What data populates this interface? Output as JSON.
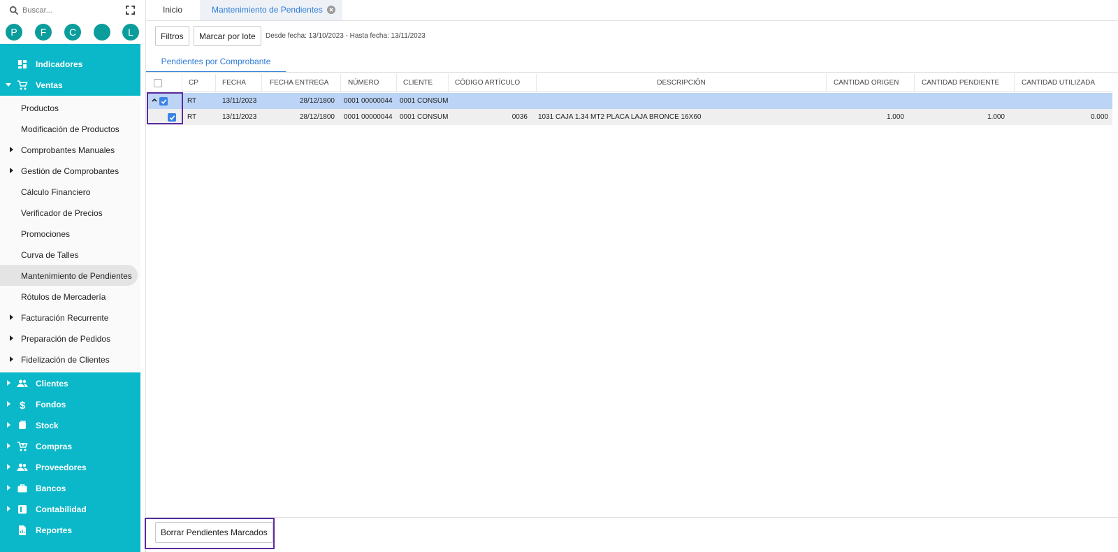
{
  "sidebar": {
    "search_placeholder": "Buscar...",
    "avatars": [
      "P",
      "F",
      "C",
      "",
      "L"
    ],
    "sections_top": [
      {
        "label": "Indicadores",
        "icon": "dashboard-icon"
      },
      {
        "label": "Ventas",
        "icon": "cart-icon",
        "expanded": true
      }
    ],
    "ventas_items": [
      {
        "label": "Productos",
        "has_children": false
      },
      {
        "label": "Modificación de Productos",
        "has_children": false
      },
      {
        "label": "Comprobantes Manuales",
        "has_children": true
      },
      {
        "label": "Gestión de Comprobantes",
        "has_children": true
      },
      {
        "label": "Cálculo Financiero",
        "has_children": false
      },
      {
        "label": "Verificador de Precios",
        "has_children": false
      },
      {
        "label": "Promociones",
        "has_children": false
      },
      {
        "label": "Curva de Talles",
        "has_children": false
      },
      {
        "label": "Mantenimiento de Pendientes",
        "has_children": false,
        "active": true
      },
      {
        "label": "Rótulos de Mercadería",
        "has_children": false
      },
      {
        "label": "Facturación Recurrente",
        "has_children": true
      },
      {
        "label": "Preparación de Pedidos",
        "has_children": true
      },
      {
        "label": "Fidelización de Clientes",
        "has_children": true
      }
    ],
    "sections_bottom": [
      {
        "label": "Clientes",
        "icon": "people-icon"
      },
      {
        "label": "Fondos",
        "icon": "dollar-icon"
      },
      {
        "label": "Stock",
        "icon": "stock-icon"
      },
      {
        "label": "Compras",
        "icon": "cart-plus-icon"
      },
      {
        "label": "Proveedores",
        "icon": "people-icon"
      },
      {
        "label": "Bancos",
        "icon": "briefcase-icon"
      },
      {
        "label": "Contabilidad",
        "icon": "book-icon"
      },
      {
        "label": "Reportes",
        "icon": "report-icon"
      }
    ]
  },
  "tabs": {
    "inicio": "Inicio",
    "active": "Mantenimiento de Pendientes"
  },
  "toolbar": {
    "filtros": "Filtros",
    "marcar_lote": "Marcar por lote",
    "date_range": "Desde fecha: 13/10/2023 - Hasta fecha: 13/11/2023"
  },
  "subtab": "Pendientes por Comprobante",
  "grid": {
    "columns": [
      "",
      "CP",
      "FECHA",
      "FECHA ENTREGA",
      "NÚMERO",
      "CLIENTE",
      "CÓDIGO ARTÍCULO",
      "DESCRIPCIÓN",
      "CANTIDAD ORIGEN",
      "CANTIDAD PENDIENTE",
      "CANTIDAD UTILIZADA"
    ],
    "group_row": {
      "checked": true,
      "cp": "RT",
      "fecha": "13/11/2023",
      "fecha_entrega": "28/12/1800",
      "numero": "0001 00000044",
      "cliente": "0001 CONSUM"
    },
    "detail_row": {
      "checked": true,
      "cp": "RT",
      "fecha": "13/11/2023",
      "fecha_entrega": "28/12/1800",
      "numero": "0001 00000044",
      "cliente": "0001 CONSUM",
      "codigo": "0036",
      "descripcion": "1031 CAJA 1.34 MT2 PLACA LAJA BRONCE 16X60",
      "cant_origen": "1.000",
      "cant_pendiente": "1.000",
      "cant_utilizada": "0.000"
    }
  },
  "footer": {
    "borrar": "Borrar Pendientes Marcados"
  },
  "colors": {
    "teal": "#0bb8c9",
    "avatar": "#0b9d9b",
    "accent": "#2e7bd6",
    "highlight": "#5b2a9e",
    "selected_row": "#bcd4f5"
  }
}
